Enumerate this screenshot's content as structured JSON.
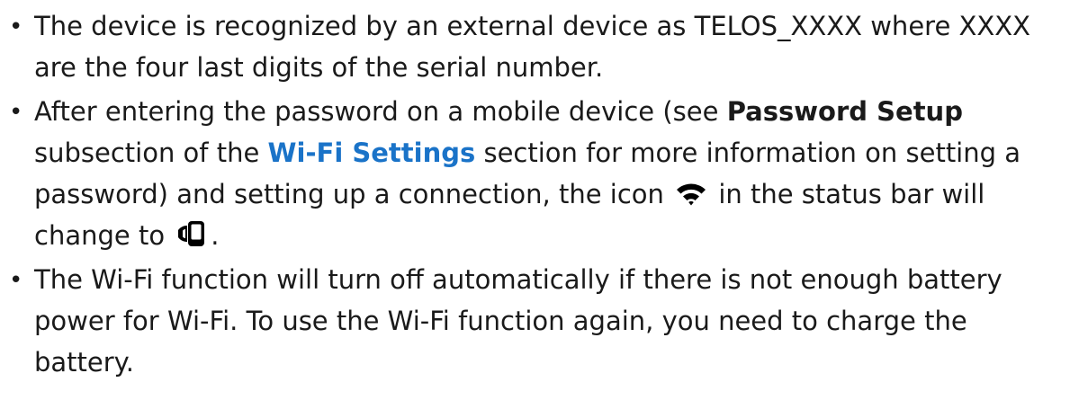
{
  "bullets": {
    "item1": {
      "text": "The device is recognized by an external device as TELOS_XXXX where XXXX are the four last digits of the serial number."
    },
    "item2": {
      "part1": "After entering the password on a mobile device (see ",
      "password_setup": "Password Setup",
      "part2": " subsection of the ",
      "wifi_settings_link": "Wi-Fi Settings",
      "part3": " section for more information on setting a password) and setting up a connection, the icon ",
      "icon_before": "wifi-icon",
      "part4": " in the status bar will change to ",
      "icon_after": "mobile-connected-icon",
      "part5": "."
    },
    "item3": {
      "text": "The Wi-Fi function will turn off automatically if there is not enough battery power for Wi-Fi. To use the Wi-Fi function again, you need to charge the battery."
    }
  },
  "bullet_glyph": "•",
  "colors": {
    "text": "#1a1a1a",
    "link": "#1a73c8"
  }
}
